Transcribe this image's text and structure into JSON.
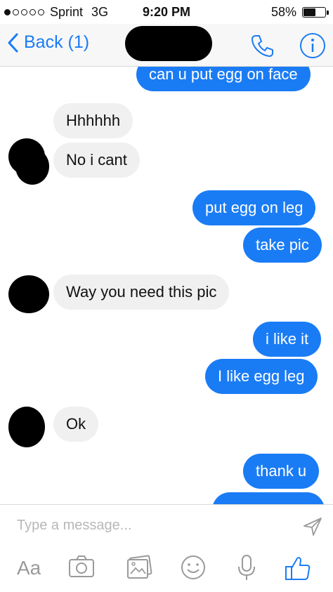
{
  "status": {
    "carrier": "Sprint",
    "network": "3G",
    "time": "9:20 PM",
    "battery": "58%",
    "battery_level": 0.58
  },
  "header": {
    "back_label": "Back (1)"
  },
  "messages": [
    {
      "side": "out",
      "text": "can u put egg on face"
    },
    {
      "side": "in",
      "text": "Hhhhhh"
    },
    {
      "side": "in",
      "text": "No i cant"
    },
    {
      "side": "out",
      "text": "put egg on leg"
    },
    {
      "side": "out",
      "text": "take pic"
    },
    {
      "side": "in",
      "text": "Way you need this pic"
    },
    {
      "side": "out",
      "text": "i like it"
    },
    {
      "side": "out",
      "text": "I like egg leg"
    },
    {
      "side": "in",
      "text": "Ok"
    },
    {
      "side": "out",
      "text": "thank u"
    }
  ],
  "composer": {
    "placeholder": "Type a message...",
    "text_tool": "Aa",
    "icons": [
      "camera-icon",
      "photo-icon",
      "emoji-icon",
      "microphone-icon",
      "like-icon"
    ]
  },
  "colors": {
    "accent": "#1a7cf5",
    "incoming_bubble": "#f0f0f0"
  }
}
